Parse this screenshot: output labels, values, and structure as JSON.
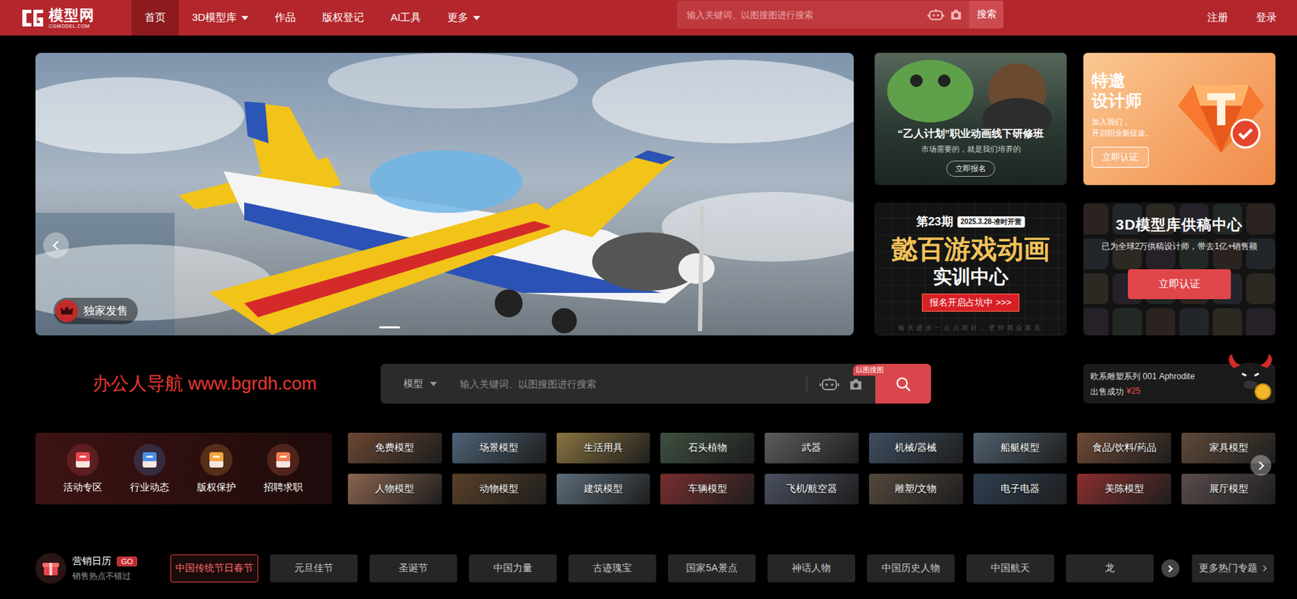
{
  "nav": {
    "logo": {
      "name": "模型网",
      "domain": "CGMODEL.COM"
    },
    "items": [
      {
        "label": "首页",
        "selected": true,
        "dropdown": false
      },
      {
        "label": "3D模型库",
        "selected": false,
        "dropdown": true
      },
      {
        "label": "作品",
        "selected": false,
        "dropdown": false
      },
      {
        "label": "版权登记",
        "selected": false,
        "dropdown": false
      },
      {
        "label": "AI工具",
        "selected": false,
        "dropdown": false
      },
      {
        "label": "更多",
        "selected": false,
        "dropdown": true
      }
    ],
    "search": {
      "placeholder": "输入关键词、以图搜图进行搜索",
      "button": "搜索"
    },
    "account": [
      "注册",
      "登录"
    ]
  },
  "carousel": {
    "badge": "独家发售",
    "dots": [
      {
        "selected": true
      }
    ]
  },
  "promos": [
    {
      "kind": "course",
      "title": "“乙人计划”职业动画线下研修班",
      "subtitle": "市场需要的，就是我们培养的",
      "button": "立即报名"
    },
    {
      "kind": "designer",
      "title_lines": [
        "特邀",
        "设计师"
      ],
      "lines": [
        "加入我们，",
        "开启职业新征途。"
      ],
      "button": "立即认证"
    },
    {
      "kind": "training",
      "issue": "第23期",
      "date": "2025.3.28-准时开营",
      "title": "懿百游戏动画",
      "subtitle": "实训中心",
      "button": "报名开启占坑中 >>>",
      "footer": "每天进步一点点就好，坚持就会看见"
    },
    {
      "kind": "supplier",
      "title": "3D模型库供稿中心",
      "subtitle": "已为全球2万供稿设计师，带去1亿+销售额",
      "button": "立即认证"
    }
  ],
  "watermark": "办公人导航 www.bgrdh.com",
  "search": {
    "category": "模型",
    "placeholder": "输入关键词、以图搜图进行搜索",
    "image_badge": "以图搜图"
  },
  "notification": {
    "title": "欧系雕塑系列 001 Aphrodite",
    "status": "出售成功",
    "price": "¥25"
  },
  "quick_links": [
    {
      "label": "活动专区",
      "color": "#e5474d"
    },
    {
      "label": "行业动态",
      "color": "#4a8fe0"
    },
    {
      "label": "版权保护",
      "color": "#f0a640"
    },
    {
      "label": "招聘求职",
      "color": "#f07c50"
    }
  ],
  "categories": [
    "免费模型",
    "场景模型",
    "生活用具",
    "石头植物",
    "武器",
    "机械/器械",
    "船艇模型",
    "食品/饮料/药品",
    "家具模型",
    "人物模型",
    "动物模型",
    "建筑模型",
    "车辆模型",
    "飞机/航空器",
    "雕塑/文物",
    "电子电器",
    "美陈模型",
    "展厅模型"
  ],
  "calendar": {
    "title": "营销日历",
    "badge": "GO",
    "subtitle": "销售热点不错过",
    "topics": [
      {
        "label": "中国传统节日春节",
        "selected": true
      },
      {
        "label": "元旦佳节",
        "selected": false
      },
      {
        "label": "圣诞节",
        "selected": false
      },
      {
        "label": "中国力量",
        "selected": false
      },
      {
        "label": "古迹瑰宝",
        "selected": false
      },
      {
        "label": "国家5A景点",
        "selected": false
      },
      {
        "label": "神话人物",
        "selected": false
      },
      {
        "label": "中国历史人物",
        "selected": false
      },
      {
        "label": "中国航天",
        "selected": false
      },
      {
        "label": "龙",
        "selected": false
      }
    ],
    "more": "更多热门专题"
  }
}
